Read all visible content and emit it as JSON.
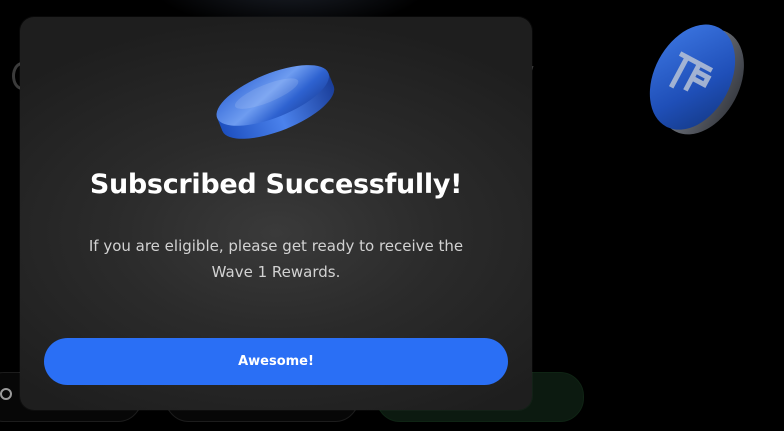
{
  "modal": {
    "title": "Subscribed Successfully!",
    "message": "If you are eligible, please get ready to receive the Wave 1 Rewards.",
    "button_label": "Awesome!"
  },
  "icons": {
    "modal_coin": "blue-coin-icon",
    "background_coin": "brand-logo-coin-icon",
    "footer_icon": "globe-icon"
  },
  "colors": {
    "primary_button": "#2a6ff5",
    "modal_background": "#2b2b2b",
    "page_background": "#000000",
    "coin_blue": "#2f63c9"
  }
}
